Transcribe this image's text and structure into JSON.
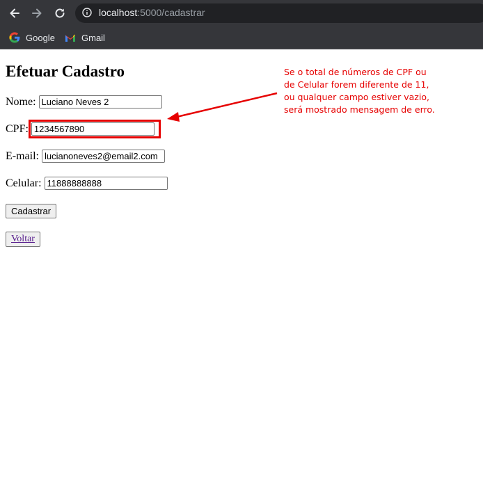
{
  "browser": {
    "url_host": "localhost",
    "url_path": ":5000/cadastrar",
    "bookmarks": [
      {
        "label": "Google"
      },
      {
        "label": "Gmail"
      }
    ]
  },
  "page": {
    "title": "Efetuar Cadastro",
    "fields": {
      "nome": {
        "label": "Nome:",
        "value": "Luciano Neves 2"
      },
      "cpf": {
        "label": "CPF:",
        "value": "1234567890"
      },
      "email": {
        "label": "E-mail:",
        "value": "lucianoneves2@email2.com"
      },
      "celular": {
        "label": "Celular:",
        "value": "11888888888"
      }
    },
    "submit_label": "Cadastrar",
    "back_label": "Voltar"
  },
  "annotation": {
    "note_lines": [
      "Se o total de números de CPF ou",
      "de Celular forem diferente de 11,",
      "ou qualquer campo estiver vazio,",
      "será mostrado mensagem de erro."
    ],
    "color": "#e60000"
  }
}
